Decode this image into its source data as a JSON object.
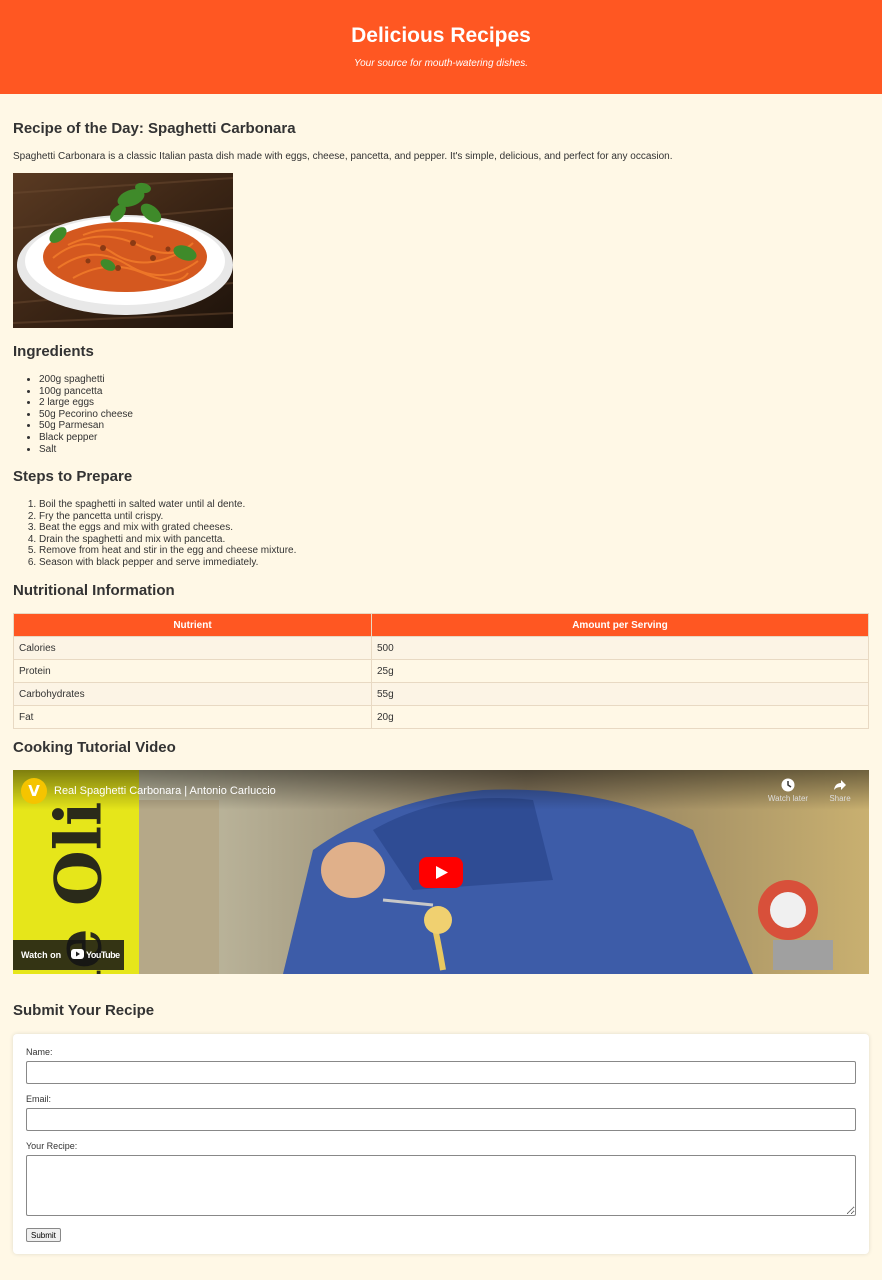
{
  "header": {
    "title": "Delicious Recipes",
    "tagline": "Your source for mouth-watering dishes."
  },
  "recipe": {
    "heading": "Recipe of the Day: Spaghetti Carbonara",
    "description": "Spaghetti Carbonara is a classic Italian pasta dish made with eggs, cheese, pancetta, and pepper. It's simple, delicious, and perfect for any occasion."
  },
  "ingredients": {
    "heading": "Ingredients",
    "items": [
      "200g spaghetti",
      "100g pancetta",
      "2 large eggs",
      "50g Pecorino cheese",
      "50g Parmesan",
      "Black pepper",
      "Salt"
    ]
  },
  "steps": {
    "heading": "Steps to Prepare",
    "items": [
      "Boil the spaghetti in salted water until al dente.",
      "Fry the pancetta until crispy.",
      "Beat the eggs and mix with grated cheeses.",
      "Drain the spaghetti and mix with pancetta.",
      "Remove from heat and stir in the egg and cheese mixture.",
      "Season with black pepper and serve immediately."
    ]
  },
  "nutrition": {
    "heading": "Nutritional Information",
    "columns": [
      "Nutrient",
      "Amount per Serving"
    ],
    "rows": [
      [
        "Calories",
        "500"
      ],
      [
        "Protein",
        "25g"
      ],
      [
        "Carbohydrates",
        "55g"
      ],
      [
        "Fat",
        "20g"
      ]
    ]
  },
  "video": {
    "heading": "Cooking Tutorial Video",
    "title": "Real Spaghetti Carbonara | Antonio Carluccio",
    "watch_later": "Watch later",
    "share": "Share",
    "watch_on": "Watch on",
    "youtube": "YouTube",
    "poster_text": "ie Oli"
  },
  "form": {
    "heading": "Submit Your Recipe",
    "name_label": "Name:",
    "email_label": "Email:",
    "recipe_label": "Your Recipe:",
    "submit_label": "Submit"
  },
  "colors": {
    "accent": "#ff5722",
    "background": "#fff8e6",
    "youtube_red": "#ff0000"
  }
}
